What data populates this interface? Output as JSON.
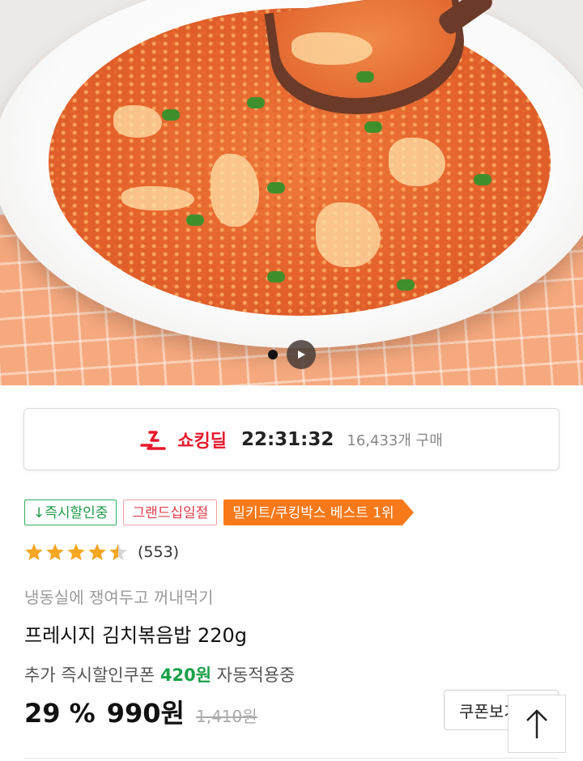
{
  "hero": {
    "image_label": "kimchi fried rice on white plate",
    "carousel_dot_icon": "carousel-dot",
    "play_icon": "play-icon"
  },
  "deal": {
    "logo_icon": "shocking-deal-logo-icon",
    "title": "쇼킹딜",
    "timer": "22:31:32",
    "purchase_count": "16,433개 구매",
    "accent_color": "#e5192c"
  },
  "badges": [
    {
      "label": "↓즉시할인중",
      "style": "green"
    },
    {
      "label": "그랜드십일절",
      "style": "red"
    },
    {
      "label": "밀키트/쿠킹박스 베스트 1위",
      "style": "orange"
    }
  ],
  "rating": {
    "score_stars": 4.5,
    "max_stars": 5,
    "review_count": "(553)",
    "star_color": "#f5a623"
  },
  "product": {
    "subtitle": "냉동실에 쟁여두고 꺼내먹기",
    "name": "프레시지 김치볶음밥 220g"
  },
  "coupon": {
    "prefix": "추가 즉시할인쿠폰",
    "amount": "420원",
    "suffix": "자동적용중",
    "amount_color": "#19a04a"
  },
  "price": {
    "discount": "29 %",
    "sale_price": "990원",
    "original_price": "1,410원"
  },
  "buttons": {
    "coupon_button": "쿠폰보기",
    "scroll_top_icon": "arrow-up-icon"
  }
}
